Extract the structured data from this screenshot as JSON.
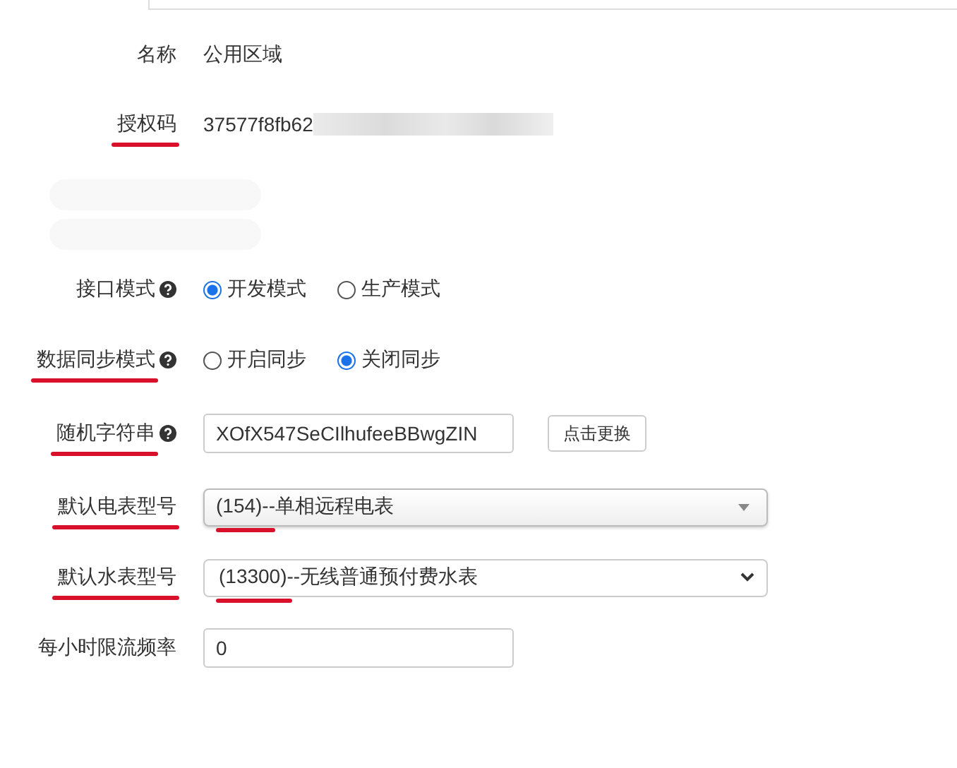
{
  "rows": [
    {
      "kind": "text",
      "label": "名称",
      "value": "公用区域",
      "underlined": false
    },
    {
      "kind": "masked-text",
      "label": "授权码",
      "value": "37577f8fb62",
      "underlined": true
    },
    {
      "kind": "redacted"
    },
    {
      "kind": "redacted"
    },
    {
      "kind": "radio",
      "label": "接口模式",
      "help": true,
      "underlined": false,
      "options": [
        {
          "label": "开发模式",
          "selected": true
        },
        {
          "label": "生产模式",
          "selected": false
        }
      ]
    },
    {
      "kind": "radio",
      "label": "数据同步模式",
      "help": true,
      "underlined": true,
      "options": [
        {
          "label": "开启同步",
          "selected": false
        },
        {
          "label": "关闭同步",
          "selected": true
        }
      ]
    },
    {
      "kind": "input-button",
      "label": "随机字符串",
      "help": true,
      "underlined": true,
      "value": "XOfX547SeCIlhufeeBBwgZIN",
      "button": "点击更换"
    },
    {
      "kind": "select-legacy",
      "label": "默认电表型号",
      "underlined": true,
      "value": "(154)--单相远程电表",
      "value_underlined": true
    },
    {
      "kind": "select",
      "label": "默认水表型号",
      "underlined": true,
      "value": "(13300)--无线普通预付费水表",
      "value_underlined": true
    },
    {
      "kind": "input",
      "label": "每小时限流频率",
      "underlined": false,
      "value": "0"
    }
  ]
}
